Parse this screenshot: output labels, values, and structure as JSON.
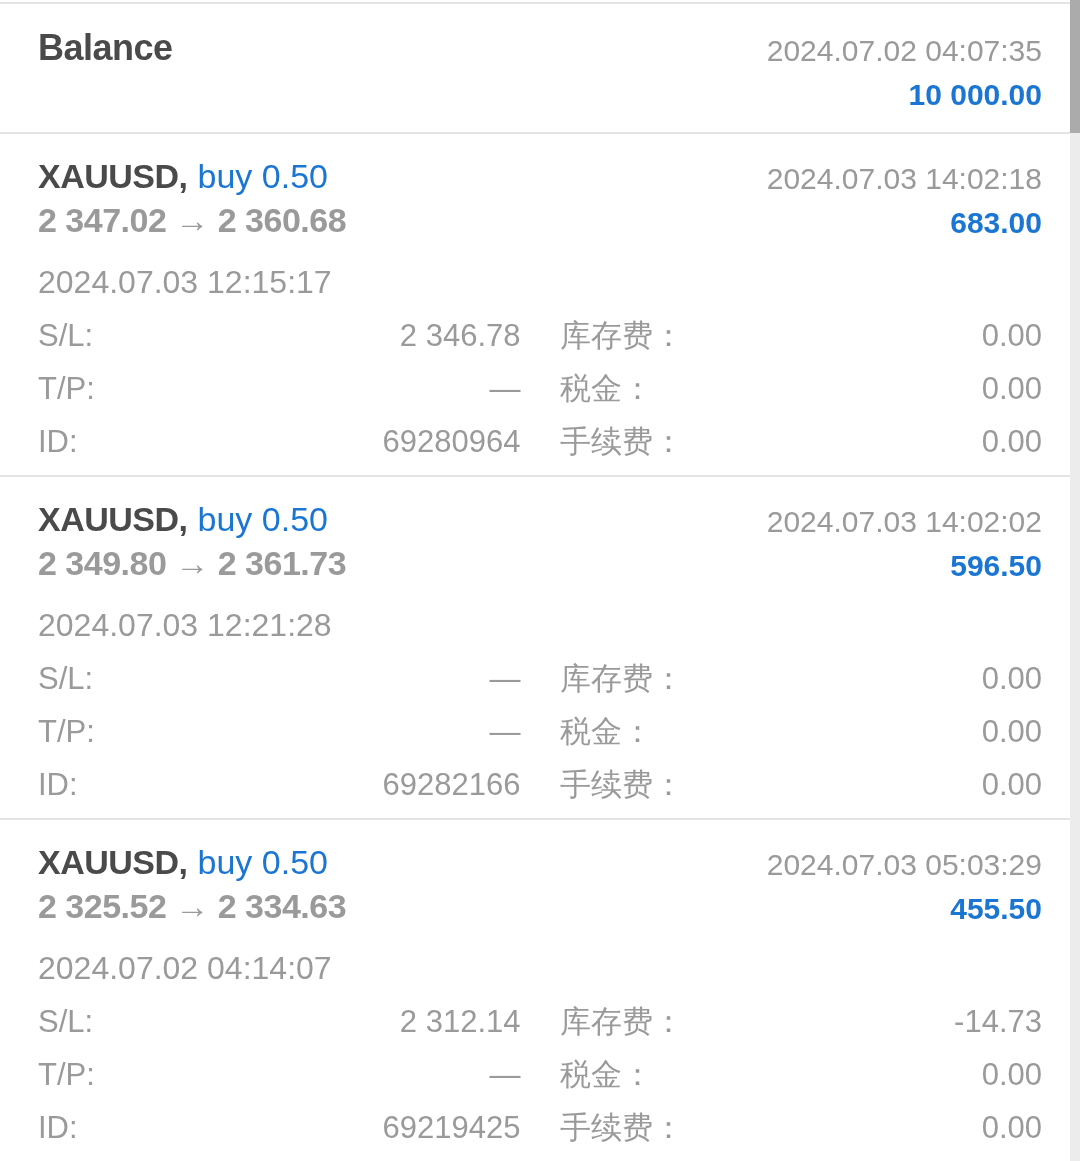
{
  "balance": {
    "title": "Balance",
    "time": "2024.07.02 04:07:35",
    "amount": "10 000.00"
  },
  "deals": [
    {
      "symbol": "XAUUSD,",
      "order": "buy 0.50",
      "prices": "**2 347.02** → **2 360.68**",
      "close_time": "2024.07.03 14:02:18",
      "profit": "683.00",
      "open_time": "2024.07.03 12:15:17",
      "details": [
        {
          "label": "S/L:",
          "value": "2 346.78"
        },
        {
          "label": "库存费：",
          "value": "0.00"
        },
        {
          "label": "T/P:",
          "value": "—"
        },
        {
          "label": "税金：",
          "value": "0.00"
        },
        {
          "label": "ID:",
          "value": "69280964"
        },
        {
          "label": "手续费：",
          "value": "0.00"
        }
      ]
    },
    {
      "symbol": "XAUUSD,",
      "order": "buy 0.50",
      "prices": "**2 349.80** → **2 361.73**",
      "close_time": "2024.07.03 14:02:02",
      "profit": "596.50",
      "open_time": "2024.07.03 12:21:28",
      "details": [
        {
          "label": "S/L:",
          "value": "—"
        },
        {
          "label": "库存费：",
          "value": "0.00"
        },
        {
          "label": "T/P:",
          "value": "—"
        },
        {
          "label": "税金：",
          "value": "0.00"
        },
        {
          "label": "ID:",
          "value": "69282166"
        },
        {
          "label": "手续费：",
          "value": "0.00"
        }
      ]
    },
    {
      "symbol": "XAUUSD,",
      "order": "buy 0.50",
      "prices": "**2 325.52** → **2 334.63**",
      "close_time": "2024.07.03 05:03:29",
      "profit": "455.50",
      "open_time": "2024.07.02 04:14:07",
      "details": [
        {
          "label": "S/L:",
          "value": "2 312.14"
        },
        {
          "label": "库存费：",
          "value": "-14.73"
        },
        {
          "label": "T/P:",
          "value": "—"
        },
        {
          "label": "税金：",
          "value": "0.00"
        },
        {
          "label": "ID:",
          "value": "69219425"
        },
        {
          "label": "手续费：",
          "value": "0.00"
        }
      ]
    }
  ]
}
